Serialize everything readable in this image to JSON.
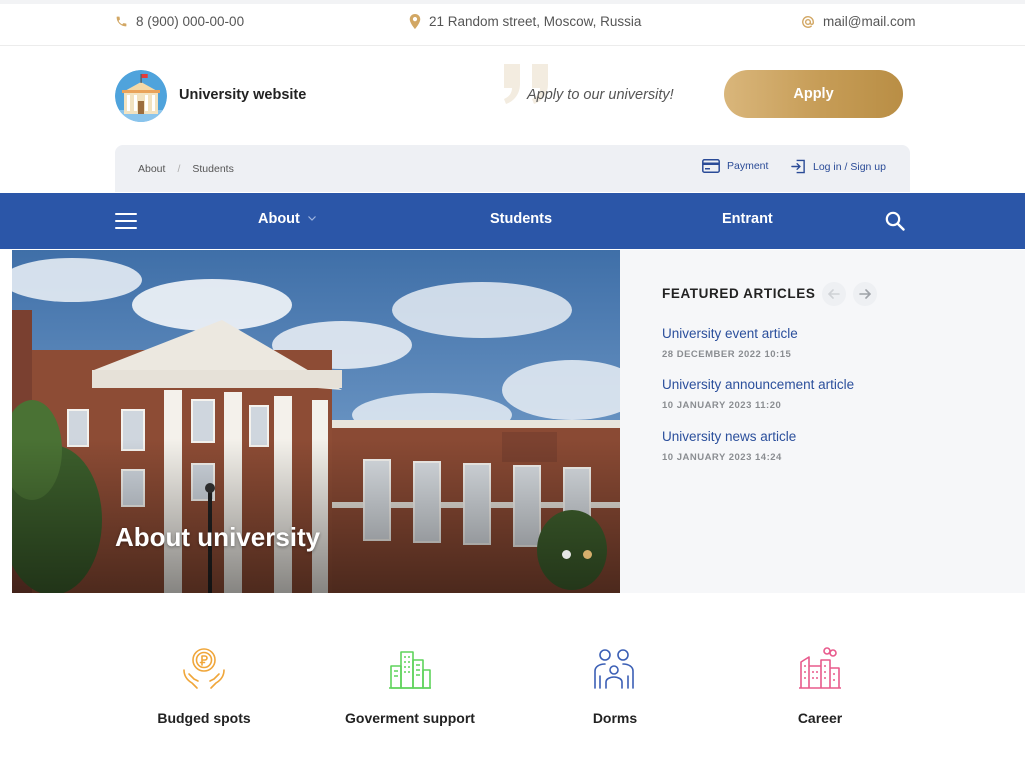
{
  "contacts": {
    "phone": "8 (900) 000-00-00",
    "address": "21 Random street, Moscow, Russia",
    "email": "mail@mail.com"
  },
  "header": {
    "site_name": "University website",
    "slogan": "Apply to our university!",
    "apply_label": "Apply"
  },
  "breadcrumb": [
    "About",
    "Students"
  ],
  "utility": {
    "payment": "Payment",
    "login": "Log in / Sign up"
  },
  "nav": {
    "items": [
      "About",
      "Students",
      "Entrant"
    ]
  },
  "hero": {
    "title": "About university",
    "slides_count": 2,
    "active_slide": 2
  },
  "featured": {
    "title": "FEATURED ARTICLES",
    "articles": [
      {
        "title": "University event article",
        "date": "28 DECEMBER 2022 10:15"
      },
      {
        "title": "University announcement article",
        "date": "10 JANUARY 2023 11:20"
      },
      {
        "title": "University news article",
        "date": "10 JANUARY 2023 14:24"
      }
    ]
  },
  "features": [
    {
      "label": "Budged spots",
      "icon": "coin-hands-icon"
    },
    {
      "label": "Goverment support",
      "icon": "city-buildings-icon"
    },
    {
      "label": "Dorms",
      "icon": "people-icon"
    },
    {
      "label": "Career",
      "icon": "factory-icon"
    }
  ],
  "colors": {
    "nav_blue": "#2b56a8",
    "gold": "#c69c56",
    "link_blue": "#2b4f9c",
    "featured_bg": "#f6f7f9"
  }
}
